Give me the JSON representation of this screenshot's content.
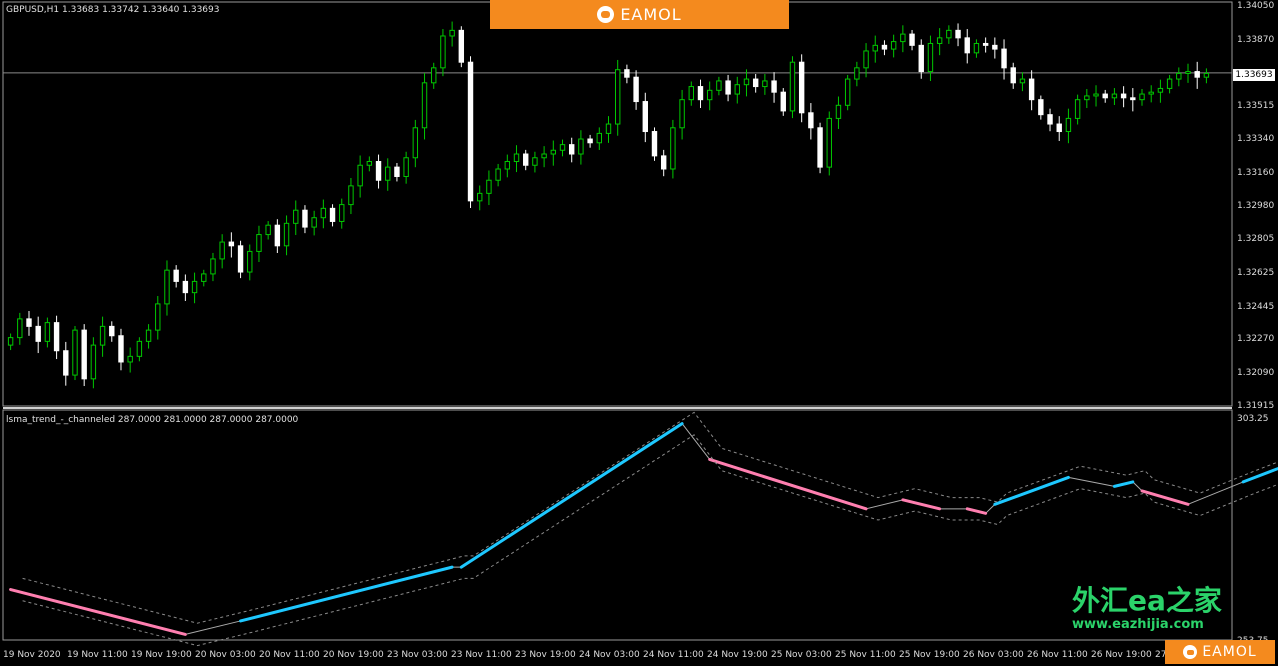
{
  "chart_data": [
    {
      "type": "candlestick",
      "symbol_line": "GBPUSD,H1  1.33683 1.33742 1.33640 1.33693",
      "y_ticks": [
        "1.34050",
        "1.33870",
        "1.33693",
        "1.33515",
        "1.33340",
        "1.33160",
        "1.32980",
        "1.32805",
        "1.32625",
        "1.32445",
        "1.32270",
        "1.32090",
        "1.31915"
      ],
      "current_price": "1.33693",
      "ylim": [
        1.31915,
        1.3405
      ],
      "colors": {
        "bull": "#00c800",
        "bear": "#ffffff",
        "grid_line": "#8a8a8a"
      },
      "series": [
        {
          "name": "close",
          "values": [
            1.3228,
            1.3238,
            1.3234,
            1.3226,
            1.3236,
            1.3221,
            1.3208,
            1.3232,
            1.3206,
            1.3224,
            1.3234,
            1.3229,
            1.3215,
            1.3218,
            1.3226,
            1.3232,
            1.3246,
            1.3264,
            1.3258,
            1.3252,
            1.3258,
            1.3262,
            1.327,
            1.3279,
            1.3277,
            1.3263,
            1.3274,
            1.3283,
            1.3288,
            1.3277,
            1.3289,
            1.3296,
            1.3287,
            1.3292,
            1.3297,
            1.329,
            1.3299,
            1.3309,
            1.332,
            1.3322,
            1.3312,
            1.3319,
            1.3314,
            1.3324,
            1.334,
            1.3364,
            1.3372,
            1.3389,
            1.3392,
            1.3375,
            1.3301,
            1.3305,
            1.3312,
            1.3318,
            1.3322,
            1.3326,
            1.332,
            1.3324,
            1.3326,
            1.3328,
            1.3331,
            1.3326,
            1.3334,
            1.3332,
            1.3337,
            1.3342,
            1.3371,
            1.3367,
            1.3354,
            1.3338,
            1.3325,
            1.3318,
            1.334,
            1.3355,
            1.3362,
            1.3355,
            1.336,
            1.3365,
            1.3358,
            1.3363,
            1.3366,
            1.3362,
            1.3365,
            1.3359,
            1.3349,
            1.3375,
            1.3348,
            1.334,
            1.3319,
            1.3345,
            1.3352,
            1.3366,
            1.3372,
            1.3381,
            1.3384,
            1.3382,
            1.3386,
            1.339,
            1.3384,
            1.337,
            1.3385,
            1.3388,
            1.3392,
            1.3388,
            1.338,
            1.3385,
            1.3384,
            1.3382,
            1.3372,
            1.3364,
            1.3366,
            1.3355,
            1.3347,
            1.3342,
            1.3338,
            1.3345,
            1.3355,
            1.3357,
            1.3358,
            1.3356,
            1.3358,
            1.3356,
            1.3355,
            1.3358,
            1.3359,
            1.3361,
            1.3366,
            1.3369,
            1.337,
            1.3367,
            1.3369
          ]
        }
      ]
    },
    {
      "type": "line",
      "title": "lsma_trend_-_channeled 287.0000 281.0000 287.0000 287.0000",
      "y_ticks": [
        "303.25",
        "253.75"
      ],
      "ylim": [
        253.75,
        303.25
      ],
      "colors": {
        "up": "#1ec8ff",
        "down": "#ff7fb0",
        "connector": "#aaaaaa",
        "channel": "#8a8a8a"
      },
      "series": [
        {
          "name": "lsma",
          "segments": [
            {
              "trend": "down",
              "x": [
                0,
                19
              ],
              "y": [
                265,
                255
              ]
            },
            {
              "trend": "up",
              "x": [
                25,
                48
              ],
              "y": [
                258,
                270
              ]
            },
            {
              "trend": "up",
              "x": [
                49,
                73
              ],
              "y": [
                270,
                302
              ]
            },
            {
              "trend": "down",
              "x": [
                76,
                93
              ],
              "y": [
                294,
                283
              ]
            },
            {
              "trend": "down",
              "x": [
                97,
                101
              ],
              "y": [
                285,
                283
              ]
            },
            {
              "trend": "down",
              "x": [
                104,
                106
              ],
              "y": [
                283,
                282
              ]
            },
            {
              "trend": "up",
              "x": [
                107,
                115
              ],
              "y": [
                284,
                290
              ]
            },
            {
              "trend": "up",
              "x": [
                120,
                122
              ],
              "y": [
                288,
                289
              ]
            },
            {
              "trend": "down",
              "x": [
                123,
                128
              ],
              "y": [
                287,
                284
              ]
            },
            {
              "trend": "up",
              "x": [
                134,
                148
              ],
              "y": [
                289,
                300
              ]
            },
            {
              "trend": "down",
              "x": [
                154,
                172
              ],
              "y": [
                297,
                284
              ]
            },
            {
              "trend": "up",
              "x": [
                178,
                179
              ],
              "y": [
                289,
                290
              ]
            }
          ]
        }
      ]
    }
  ],
  "time_labels": [
    "19 Nov 2020",
    "19 Nov 11:00",
    "19 Nov 19:00",
    "20 Nov 03:00",
    "20 Nov 11:00",
    "20 Nov 19:00",
    "23 Nov 03:00",
    "23 Nov 11:00",
    "23 Nov 19:00",
    "24 Nov 03:00",
    "24 Nov 11:00",
    "24 Nov 19:00",
    "25 Nov 03:00",
    "25 Nov 11:00",
    "25 Nov 19:00",
    "26 Nov 03:00",
    "26 Nov 11:00",
    "26 Nov 19:00",
    "27"
  ],
  "branding": {
    "top": "EAMOL",
    "bottom": "EAMOL"
  },
  "watermark": {
    "cn": "外汇ea之家",
    "url": "www.eazhijia.com"
  }
}
